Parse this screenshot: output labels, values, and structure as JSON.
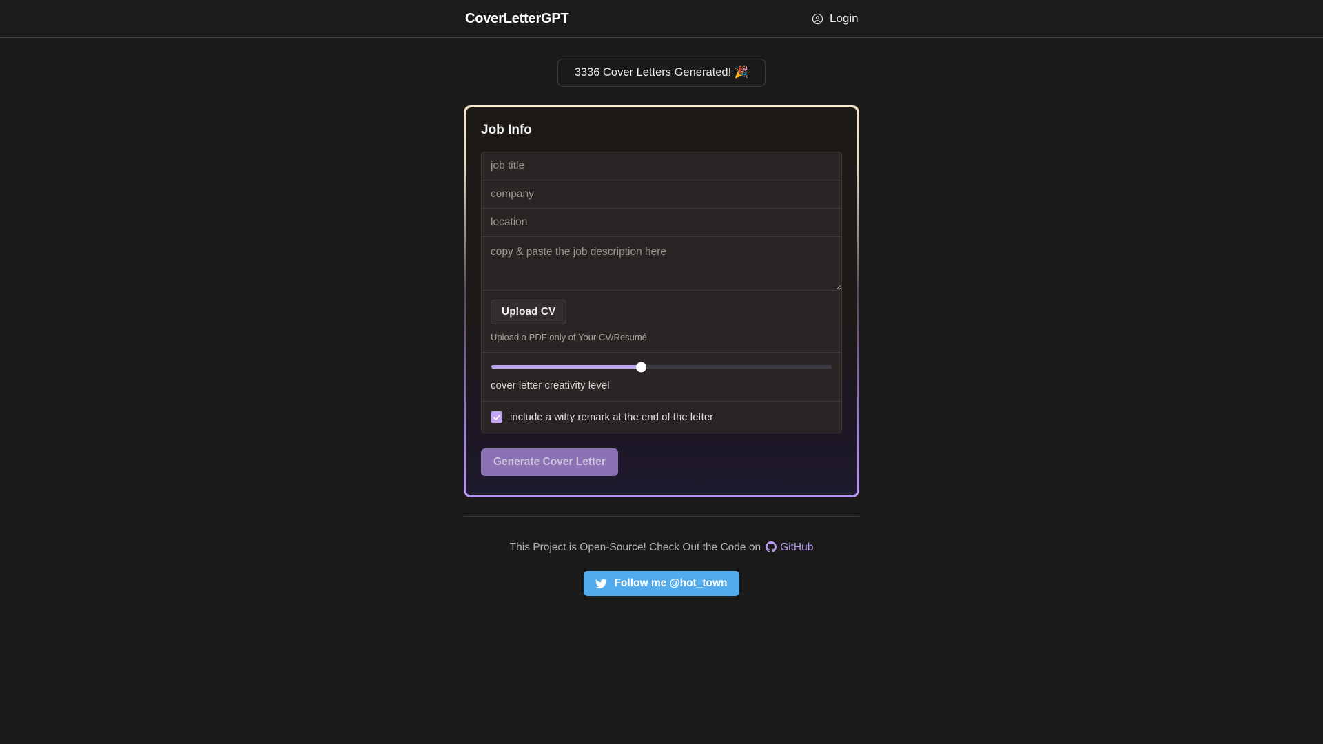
{
  "header": {
    "title": "CoverLetterGPT",
    "login_label": "Login",
    "login_icon": "user-circle-icon"
  },
  "counter": {
    "text": "3336 Cover Letters Generated! 🎉"
  },
  "card": {
    "title": "Job Info",
    "border_gradient_top": "#f6e7cd",
    "border_gradient_bottom": "#b794f4",
    "fields": {
      "job_title": {
        "value": "",
        "placeholder": "job title"
      },
      "company": {
        "value": "",
        "placeholder": "company"
      },
      "location": {
        "value": "",
        "placeholder": "location"
      },
      "description": {
        "value": "",
        "placeholder": "copy & paste the job description here"
      }
    },
    "upload": {
      "button_label": "Upload CV",
      "hint": "Upload a PDF only of Your CV/Resumé"
    },
    "slider": {
      "label": "cover letter creativity level",
      "value_percent": 44,
      "fill_color": "#bda6f0",
      "thumb_color": "#ffffff"
    },
    "checkbox": {
      "label": "include a witty remark at the end of the letter",
      "checked": true,
      "color": "#c3a6f5"
    },
    "generate": {
      "label": "Generate Cover Letter",
      "color": "#8a72b5",
      "disabled": true
    }
  },
  "footer": {
    "open_source_text": "This Project is Open-Source! Check Out the Code on",
    "github_label": "GitHub",
    "github_icon": "github-icon",
    "github_color": "#b79cef",
    "twitter_label": "Follow me @hot_town",
    "twitter_icon": "twitter-bird-icon",
    "twitter_color": "#51abec"
  }
}
